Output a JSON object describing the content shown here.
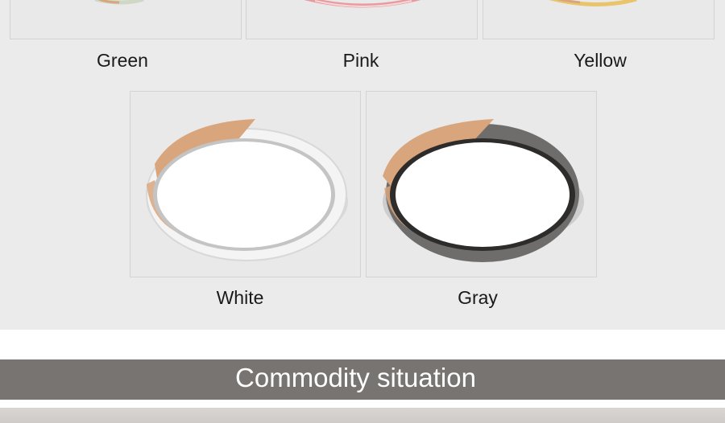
{
  "colors": {
    "gallery_bg": "#ebebeb",
    "banner_bg": "#787472",
    "banner_text": "#ffffff",
    "wood": "#d9a57c"
  },
  "variants": [
    {
      "label": "Green",
      "shade": "#cfd8c4",
      "icon": "ceiling-lamp-green-icon"
    },
    {
      "label": "Pink",
      "shade": "#e79aa0",
      "icon": "ceiling-lamp-pink-icon"
    },
    {
      "label": "Yellow",
      "shade": "#e9c46a",
      "icon": "ceiling-lamp-yellow-icon"
    },
    {
      "label": "White",
      "shade": "#f2f2f2",
      "icon": "ceiling-lamp-white-icon"
    },
    {
      "label": "Gray",
      "shade": "#6f6d6c",
      "icon": "ceiling-lamp-gray-icon"
    }
  ],
  "section": {
    "title": "Commodity situation"
  }
}
